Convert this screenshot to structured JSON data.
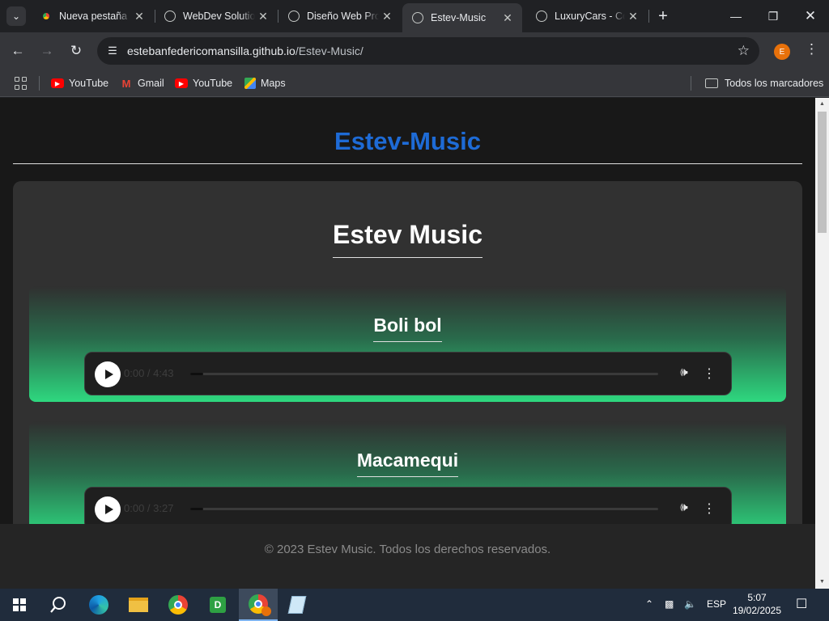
{
  "browser": {
    "tabs": [
      {
        "title": "Nueva pestaña",
        "favicon": "chrome-icon",
        "active": false
      },
      {
        "title": "WebDev Solutions",
        "favicon": "globe-icon",
        "active": false
      },
      {
        "title": "Diseño Web Pro",
        "favicon": "globe-icon",
        "active": false
      },
      {
        "title": "Estev-Music",
        "favicon": "globe-icon",
        "active": true
      },
      {
        "title": "LuxuryCars - Co",
        "favicon": "globe-icon",
        "active": false
      }
    ],
    "url_host": "estebanfedericomansilla.github.io",
    "url_path": "/Estev-Music/",
    "profile_initial": "E",
    "bookmarks": [
      {
        "label": "YouTube",
        "icon": "youtube-icon"
      },
      {
        "label": "Gmail",
        "icon": "gmail-icon"
      },
      {
        "label": "YouTube",
        "icon": "youtube-icon"
      },
      {
        "label": "Maps",
        "icon": "maps-icon"
      }
    ],
    "all_bookmarks": "Todos los marcadores"
  },
  "page": {
    "site_title": "Estev-Music",
    "heading": "Estev Music",
    "songs": [
      {
        "title": "Boli bol",
        "time": "0:00 / 4:43"
      },
      {
        "title": "Macamequi",
        "time": "0:00 / 3:27"
      }
    ],
    "footer": "© 2023 Estev Music. Todos los derechos reservados."
  },
  "colors": {
    "site_title": "#1e6bd6",
    "song_gradient_end": "#2ed87f"
  },
  "taskbar": {
    "lang": "ESP",
    "time": "5:07",
    "date": "19/02/2025"
  }
}
